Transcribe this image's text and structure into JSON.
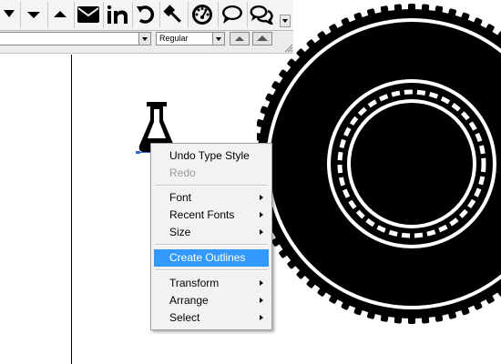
{
  "glyph_palette": {
    "glyphs": [
      "sort-down-glyph",
      "caret-down-glyph",
      "caret-up-glyph",
      "envelope-glyph",
      "linkedin-glyph",
      "rotate-glyph",
      "gavel-glyph",
      "dashboard-glyph",
      "comment-glyph",
      "comments-glyph"
    ]
  },
  "font_row": {
    "family_value": "",
    "style_value": "Regular"
  },
  "context_menu": {
    "items": [
      {
        "label": "Undo Type Style",
        "enabled": true,
        "submenu": false
      },
      {
        "label": "Redo",
        "enabled": false,
        "submenu": false
      },
      {
        "label": "Font",
        "enabled": true,
        "submenu": true
      },
      {
        "label": "Recent Fonts",
        "enabled": true,
        "submenu": true
      },
      {
        "label": "Size",
        "enabled": true,
        "submenu": true
      },
      {
        "label": "Create Outlines",
        "enabled": true,
        "submenu": false,
        "highlighted": true
      },
      {
        "label": "Transform",
        "enabled": true,
        "submenu": true
      },
      {
        "label": "Arrange",
        "enabled": true,
        "submenu": true
      },
      {
        "label": "Select",
        "enabled": true,
        "submenu": true
      }
    ]
  },
  "colors": {
    "highlight": "#3399ff",
    "selection": "#3a68d8",
    "artwork": "#000000"
  }
}
